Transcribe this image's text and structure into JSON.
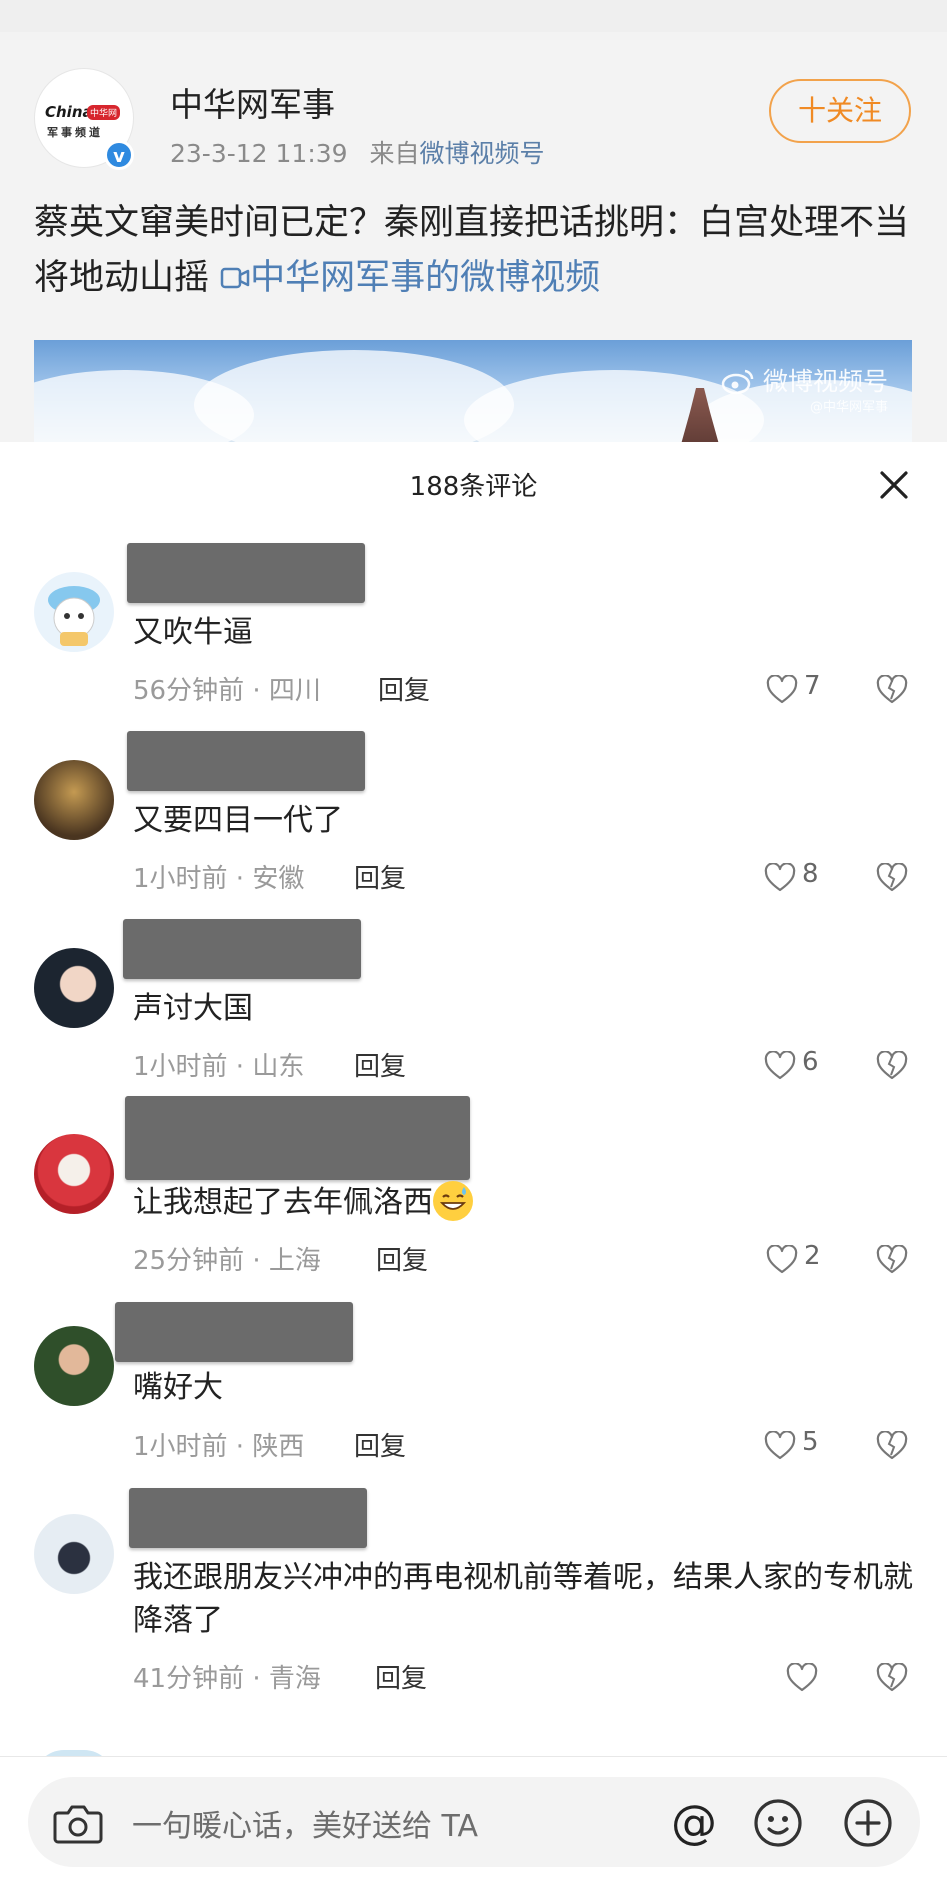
{
  "post": {
    "author": "中华网军事",
    "avatar_logo": "China",
    "avatar_logo_tag": "中华网",
    "avatar_logo_sub": "军事频道",
    "time": "23-3-12 11:39",
    "source_prefix": "来自",
    "source": "微博视频号",
    "follow_label": "十关注",
    "text": "蔡英文窜美时间已定？秦刚直接把话挑明：白宫处理不当将地动山摇",
    "video_link": "中华网军事的微博视频",
    "watermark": "微博视频号",
    "watermark_sub": "@中华网军事"
  },
  "comments_sheet": {
    "title": "188条评论",
    "comments": [
      {
        "text": "又吹牛逼",
        "time": "56分钟前",
        "location": "四川",
        "reply": "回复",
        "likes": "7"
      },
      {
        "text": "又要四目一代了",
        "time": "1小时前",
        "location": "安徽",
        "reply": "回复",
        "likes": "8"
      },
      {
        "text": "声讨大国",
        "time": "1小时前",
        "location": "山东",
        "reply": "回复",
        "likes": "6"
      },
      {
        "text": "让我想起了去年佩洛西",
        "time": "25分钟前",
        "location": "上海",
        "reply": "回复",
        "likes": "2"
      },
      {
        "text": "嘴好大",
        "time": "1小时前",
        "location": "陕西",
        "reply": "回复",
        "likes": "5"
      },
      {
        "text": "我还跟朋友兴冲冲的再电视机前等着呢，结果人家的专机就降落了",
        "time": "41分钟前",
        "location": "青海",
        "reply": "回复",
        "likes": ""
      }
    ]
  },
  "input_bar": {
    "placeholder": "一句暖心话，美好送给 TA",
    "at_symbol": "@"
  },
  "colors": {
    "follow": "#f08a24",
    "link": "#4f7fb5",
    "verify": "#2f8ae0",
    "meta": "#9a9a9a"
  }
}
